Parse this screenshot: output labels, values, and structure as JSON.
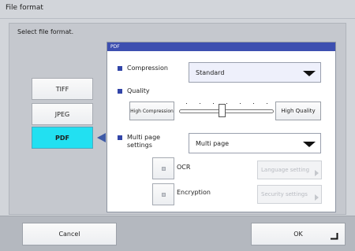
{
  "window": {
    "title": "File format"
  },
  "prompt": "Select file format.",
  "formats": [
    {
      "label": "TIFF",
      "selected": false
    },
    {
      "label": "JPEG",
      "selected": false
    },
    {
      "label": "PDF",
      "selected": true
    }
  ],
  "pdf": {
    "header": "PDF",
    "compression": {
      "label": "Compression",
      "value": "Standard"
    },
    "quality": {
      "label": "Quality",
      "left_button": "High Compression",
      "right_button": "High Quality",
      "slider_level": 0.45
    },
    "multipage": {
      "label": "Multi page\nsettings",
      "value": "Multi page"
    },
    "ocr": {
      "label": "OCR",
      "checked": false,
      "button": "Language setting",
      "button_enabled": false
    },
    "encryption": {
      "label": "Encryption",
      "checked": false,
      "button": "Security settings",
      "button_enabled": false
    }
  },
  "footer": {
    "cancel": "Cancel",
    "ok": "OK"
  },
  "colors": {
    "accent": "#3d4fb0",
    "selected": "#22e0f1"
  },
  "icons": {
    "enter": "enter-return-icon",
    "dropdown": "caret-down-icon"
  }
}
